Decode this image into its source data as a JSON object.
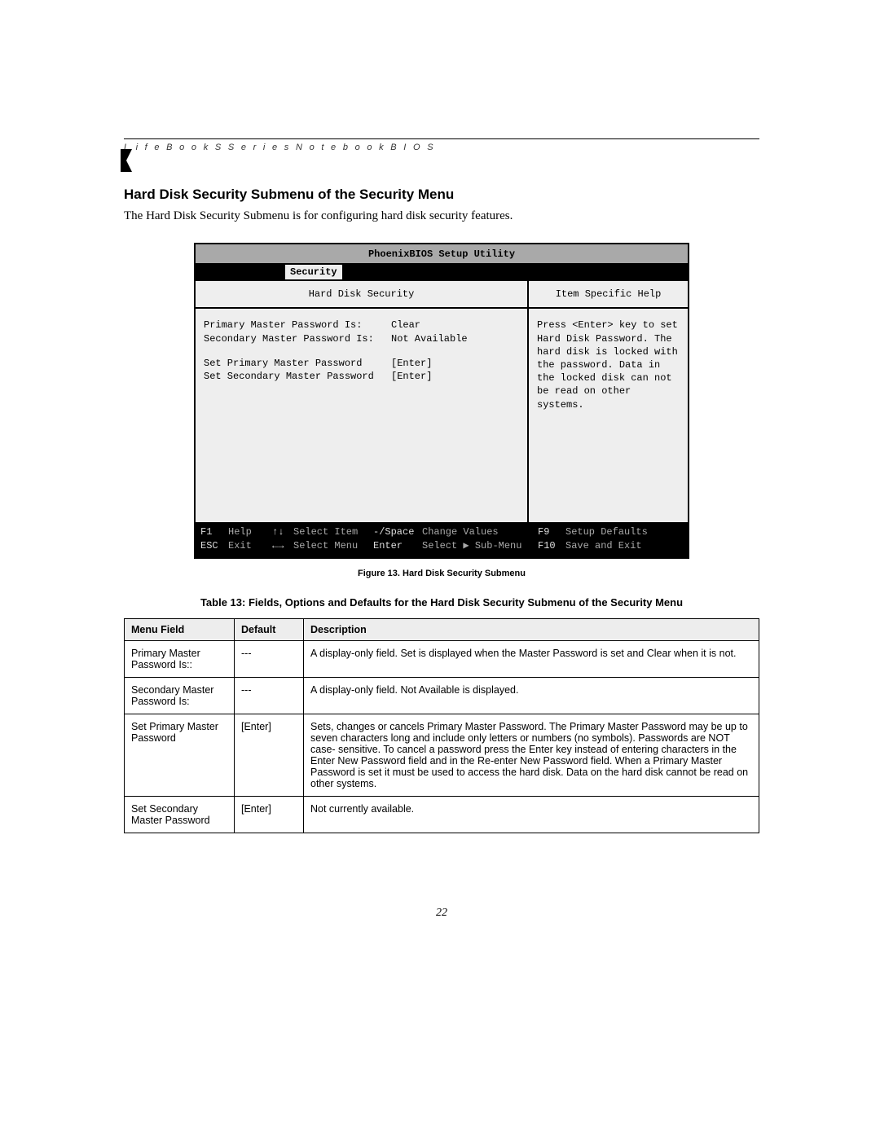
{
  "header": {
    "running_title": "L i f e B o o k   S   S e r i e s   N o t e b o o k   B I O S"
  },
  "section": {
    "title": "Hard Disk Security Submenu of the Security Menu",
    "intro": "The Hard Disk Security Submenu is for configuring hard disk security features."
  },
  "bios": {
    "title": "PhoenixBIOS Setup Utility",
    "active_tab": "Security",
    "left_heading": "Hard Disk Security",
    "right_heading": "Item Specific Help",
    "fields": [
      {
        "label": "Primary Master Password Is:",
        "value": "Clear"
      },
      {
        "label": "Secondary Master Password Is:",
        "value": "Not Available"
      },
      {
        "label": "Set Primary Master Password",
        "value": "[Enter]"
      },
      {
        "label": "Set Secondary Master Password",
        "value": "[Enter]"
      }
    ],
    "help_text": "Press <Enter> key to set Hard Disk Password. The hard disk is locked with the password. Data in the locked disk can not be read on other systems.",
    "footer": {
      "r1": {
        "k1": "F1",
        "v1": "Help",
        "k2": "↑↓",
        "v2": "Select Item",
        "k3": "-/Space",
        "v3": "Change Values",
        "k4": "F9",
        "v4": "Setup Defaults"
      },
      "r2": {
        "k1": "ESC",
        "v1": "Exit",
        "k2": "←→",
        "v2": "Select Menu",
        "k3": "Enter",
        "v3": "Select ▶ Sub-Menu",
        "k4": "F10",
        "v4": "Save and Exit"
      }
    }
  },
  "figure_caption": "Figure 13.  Hard Disk Security Submenu",
  "table_caption": "Table 13: Fields, Options and Defaults for the Hard Disk Security Submenu of the Security Menu",
  "table": {
    "headers": {
      "c1": "Menu Field",
      "c2": "Default",
      "c3": "Description"
    },
    "rows": [
      {
        "field": "Primary Master Password Is::",
        "def": "---",
        "desc": "A display-only field. Set is displayed when the Master Password is set and Clear when it is not."
      },
      {
        "field": "Secondary Master Password Is:",
        "def": "---",
        "desc": "A display-only field. Not Available is displayed."
      },
      {
        "field": "Set Primary Master Password",
        "def": "[Enter]",
        "desc": "Sets, changes or cancels Primary Master Password. The Primary Master Password may be up to seven characters long and include only letters or numbers (no symbols). Passwords are NOT case- sensitive. To cancel a password press the Enter key instead of entering characters in the Enter New Password field and in the Re-enter New Password field. When a Primary Master Password is set it must be used to access the hard disk. Data on the hard disk cannot be read on other systems."
      },
      {
        "field": "Set Secondary Master Password",
        "def": "[Enter]",
        "desc": "Not currently available."
      }
    ]
  },
  "page_number": "22"
}
